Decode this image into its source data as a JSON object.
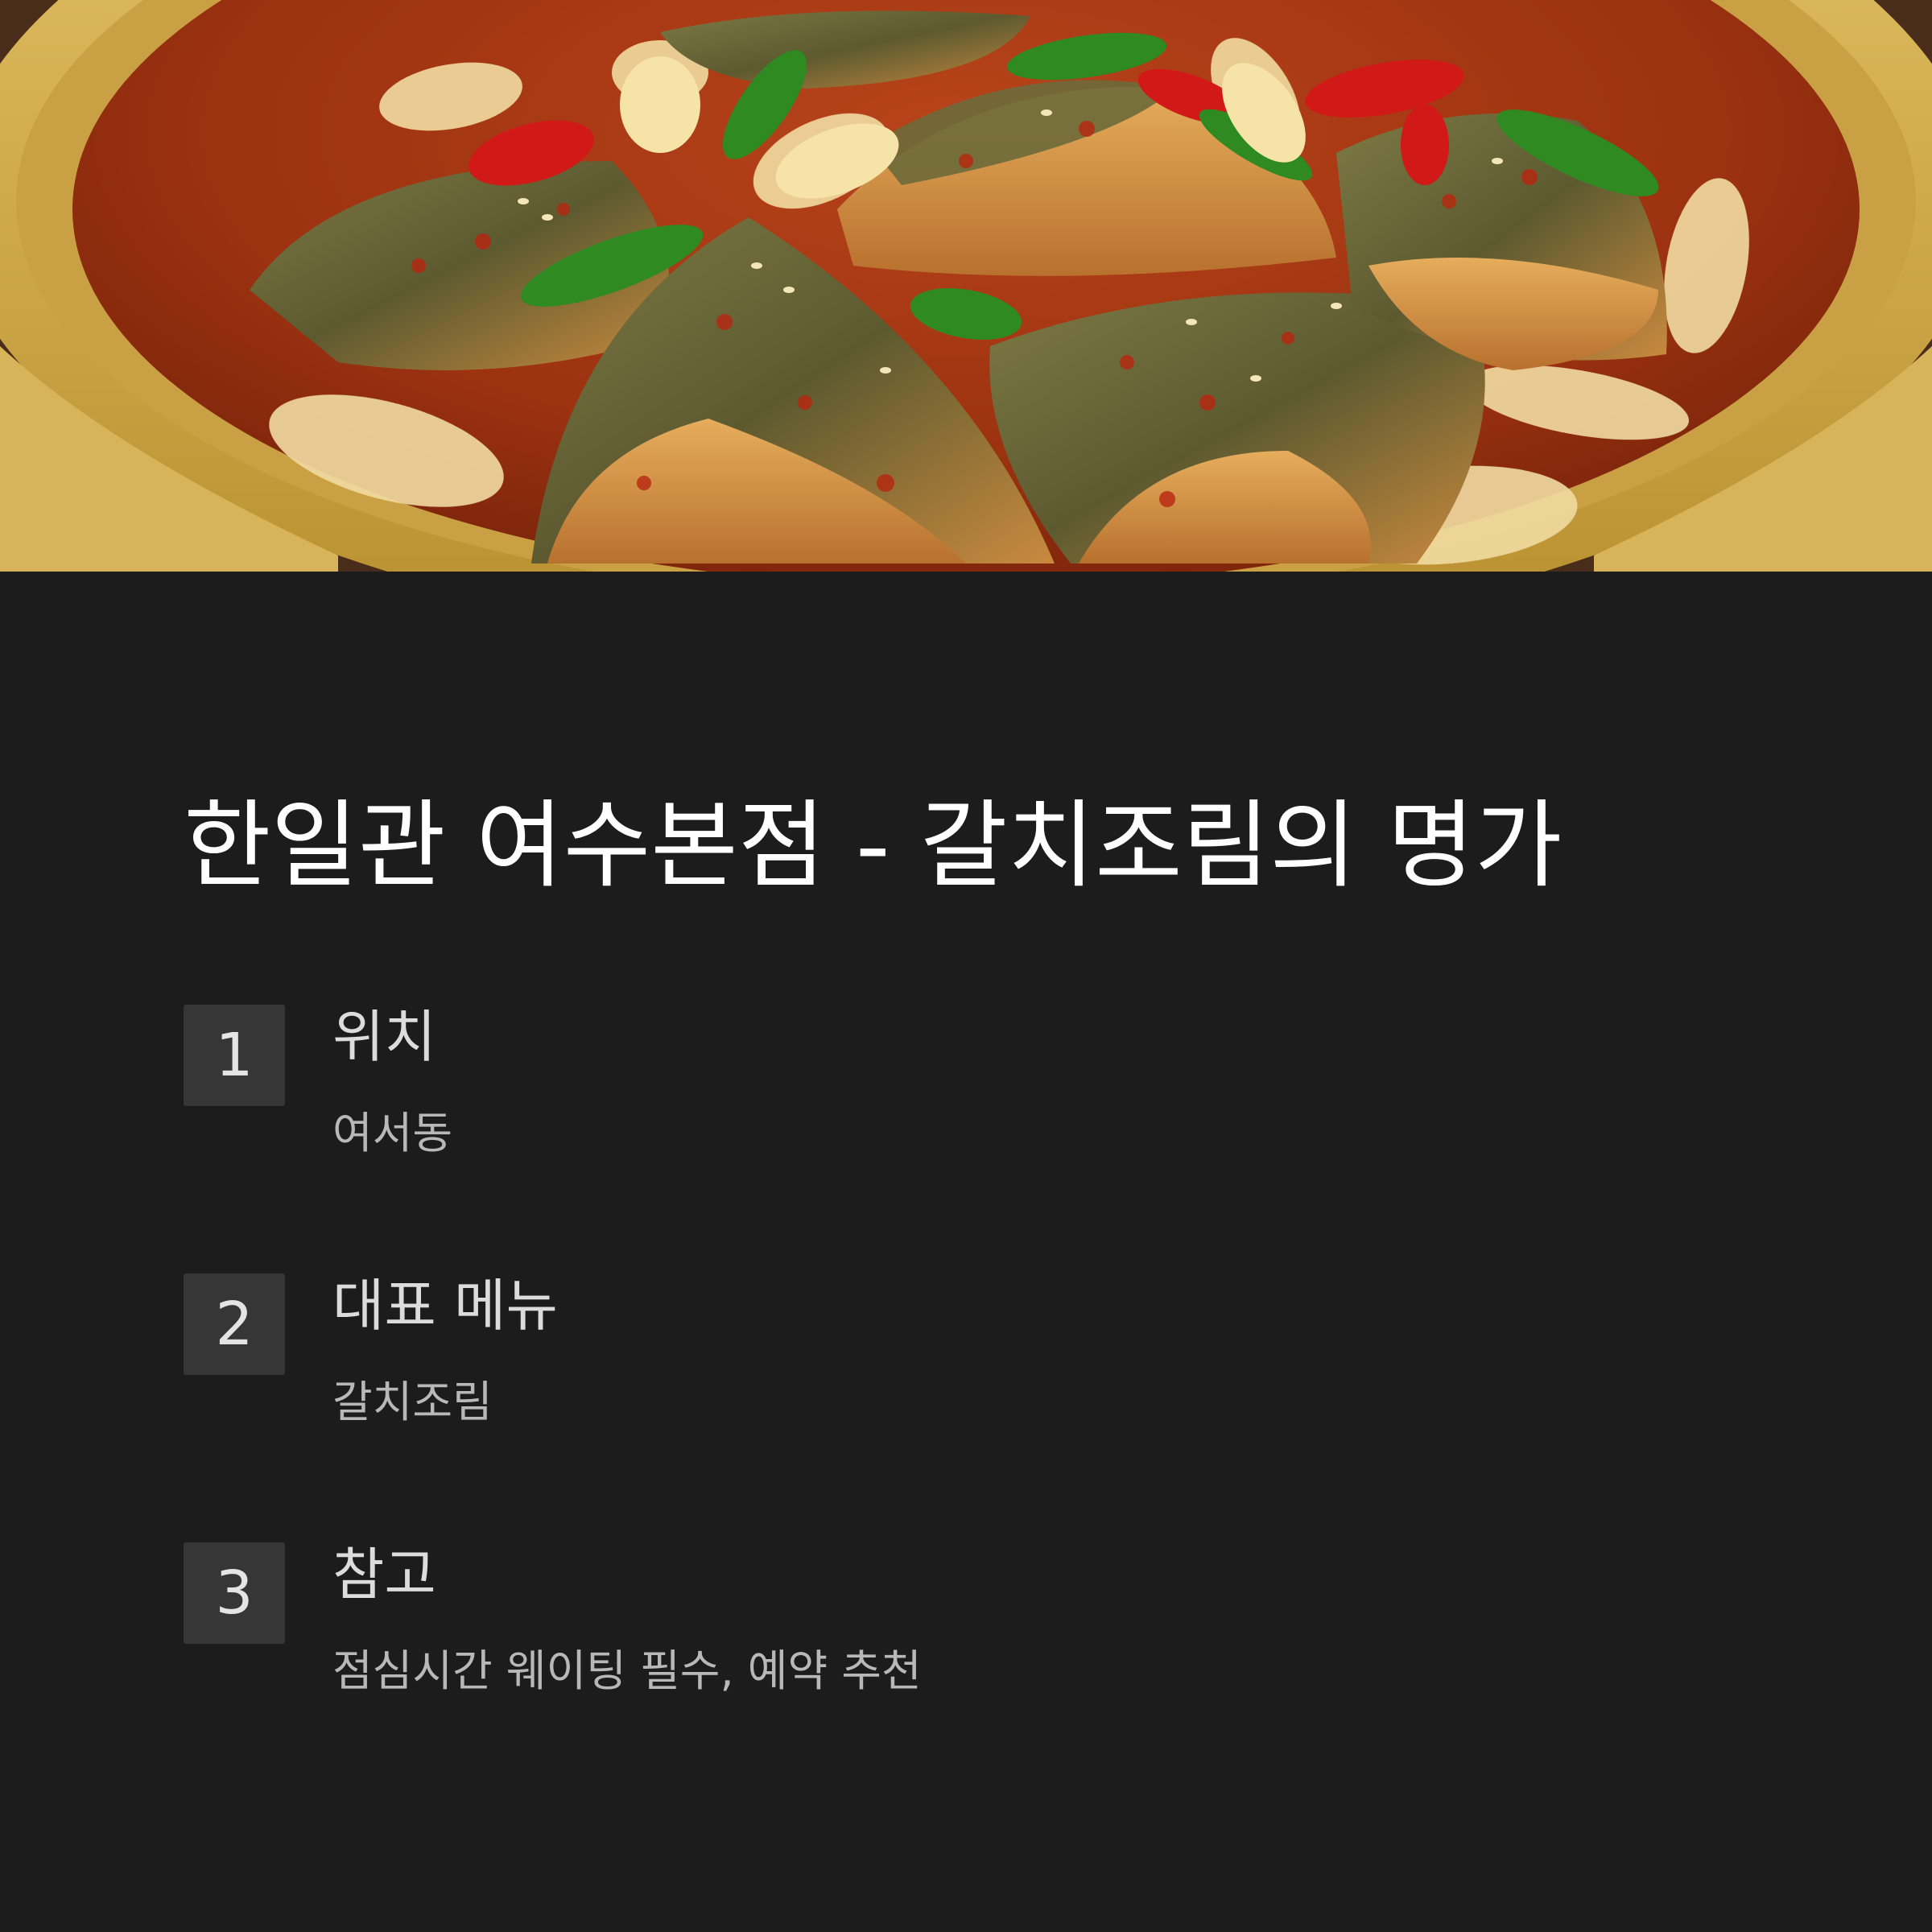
{
  "hero": {
    "icon": "braised-fish-stew-photo",
    "colors": {
      "pot": "#d9b24f",
      "broth": "#9c3210",
      "fish_skin": "#6d6a3a",
      "fish_flesh": "#d99a4c",
      "red_pepper": "#d11a17",
      "green_pepper": "#2f8a22",
      "onion": "#f0d9a0"
    }
  },
  "title": "한일관 여수본점 - 갈치조림의 명가",
  "items": [
    {
      "number": "1",
      "label": "위치",
      "value": "여서동"
    },
    {
      "number": "2",
      "label": "대표 메뉴",
      "value": "갈치조림"
    },
    {
      "number": "3",
      "label": "참고",
      "value": "점심시간 웨이팅 필수, 예약 추천"
    }
  ]
}
